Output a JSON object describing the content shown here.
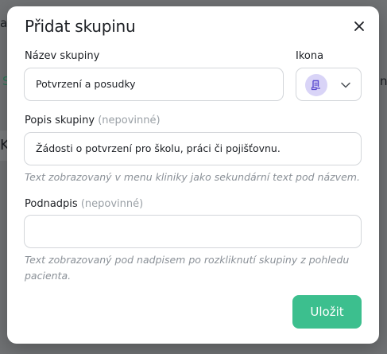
{
  "background": {
    "fragment_top_left": "ac",
    "fragment_tab": "S",
    "fragment_heading": "K",
    "fragment_right": "na"
  },
  "modal": {
    "title": "Přidat skupinu",
    "close_icon": "close-icon",
    "name_field": {
      "label": "Název skupiny",
      "value": "Potvrzení a posudky"
    },
    "icon_field": {
      "label": "Ikona",
      "icon": "document-stamp-icon",
      "dropdown_icon": "chevron-down-icon"
    },
    "description_field": {
      "label": "Popis skupiny",
      "optional": "(nepovinné)",
      "value": "Žádosti o potvrzení pro školu, práci či pojišťovnu.",
      "hint": "Text zobrazovaný v menu kliniky jako sekundární text pod názvem."
    },
    "subtitle_field": {
      "label": "Podnadpis",
      "optional": "(nepovinné)",
      "value": "",
      "hint_line1": "Text zobrazovaný pod nadpisem po rozkliknutí skupiny z pohledu",
      "hint_line2": "pacienta."
    },
    "save_label": "Uložit"
  },
  "colors": {
    "accent": "#3cbf8e",
    "icon_chip": "#d9d4f7",
    "icon_stroke": "#5b4ccf"
  }
}
